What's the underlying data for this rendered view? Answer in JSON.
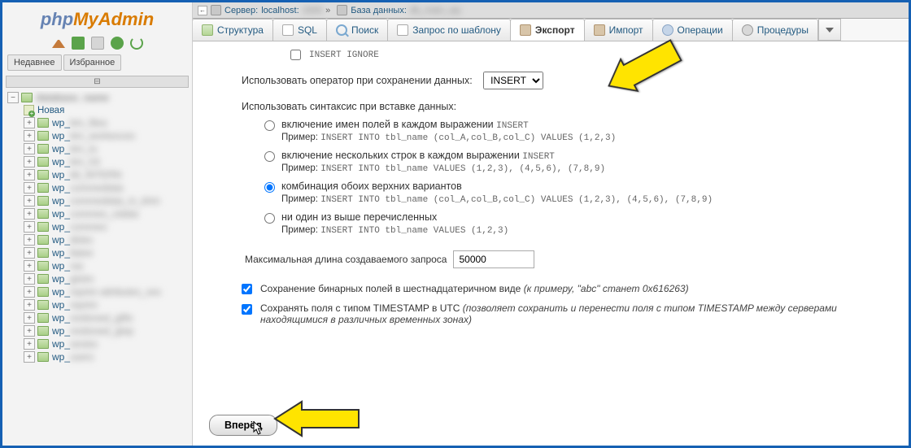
{
  "logo": {
    "php": "php",
    "myadmin": "MyAdmin"
  },
  "sidebar": {
    "recent": "Недавнее",
    "favorites": "Избранное",
    "new": "Новая",
    "tree_root_blur": "database_name",
    "items": [
      "wp_bm_filea",
      "wp_bm_workexces",
      "wp_bm_to",
      "wp_bm_h3",
      "wp_bll_INTERN",
      "wp_commediata",
      "wp_commediata_in_khm",
      "wp_commes_cidata",
      "wp_commes",
      "wp_dloks",
      "wp_llatee",
      "wp_ras",
      "wp_glotm",
      "wp_reprim attributes_vex",
      "wp_reprim",
      "wp_resiloned_gifts",
      "wp_resiloned_glop",
      "wp_sexies",
      "wp_users"
    ]
  },
  "breadcrumb": {
    "server_label": "Сервер:",
    "server_val": "localhost:",
    "server_blur": "3306",
    "db_label": "База данных:",
    "db_blur": "db_main_wp"
  },
  "tabs": {
    "structure": "Структура",
    "sql": "SQL",
    "search": "Поиск",
    "template": "Запрос по шаблону",
    "export": "Экспорт",
    "import": "Импорт",
    "operations": "Операции",
    "procedures": "Процедуры"
  },
  "form": {
    "insert_ignore": "INSERT IGNORE",
    "stmt_label": "Использовать оператор при сохранении данных:",
    "stmt_value": "INSERT",
    "syntax_label": "Использовать синтаксис при вставке данных:",
    "r1_label": "включение имен полей в каждом выражении",
    "r1_kw": "INSERT",
    "r1_hint_l": "Пример:",
    "r1_hint": "INSERT INTO tbl_name (col_A,col_B,col_C) VALUES (1,2,3)",
    "r2_label": "включение нескольких строк в каждом выражении",
    "r2_kw": "INSERT",
    "r2_hint_l": "Пример:",
    "r2_hint": "INSERT INTO tbl_name VALUES (1,2,3), (4,5,6), (7,8,9)",
    "r3_label": "комбинация обоих верхних вариантов",
    "r3_hint_l": "Пример:",
    "r3_hint": "INSERT INTO tbl_name (col_A,col_B,col_C) VALUES (1,2,3), (4,5,6), (7,8,9)",
    "r4_label": "ни один из выше перечисленных",
    "r4_hint_l": "Пример:",
    "r4_hint": "INSERT INTO tbl_name VALUES (1,2,3)",
    "maxlen_label": "Максимальная длина создаваемого запроса",
    "maxlen_value": "50000",
    "hex_label": "Сохранение бинарных полей в шестнадцатеричном виде",
    "hex_note": "(к примеру, \"abc\" станет 0x616263)",
    "ts_label": "Сохранять поля с типом TIMESTAMP в UTC",
    "ts_note": "(позволяет сохранить и перенести поля с типом TIMESTAMP между серверами находящимися в различных временных зонах)",
    "submit": "Вперёд"
  }
}
